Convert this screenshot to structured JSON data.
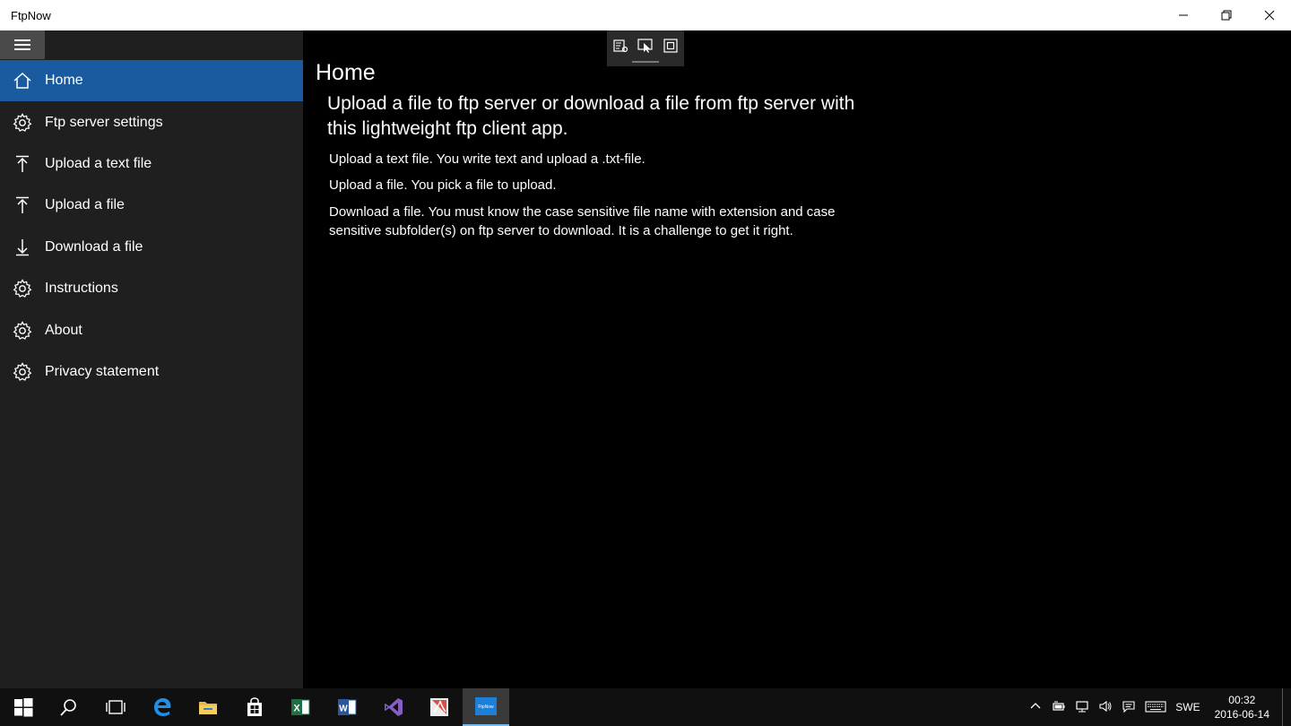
{
  "window": {
    "title": "FtpNow"
  },
  "sidebar": {
    "items": [
      {
        "label": "Home",
        "icon": "home-icon",
        "active": true
      },
      {
        "label": "Ftp server settings",
        "icon": "gear-icon"
      },
      {
        "label": "Upload a text file",
        "icon": "upload-icon"
      },
      {
        "label": "Upload a file",
        "icon": "upload-icon"
      },
      {
        "label": "Download a file",
        "icon": "download-icon"
      },
      {
        "label": "Instructions",
        "icon": "gear-icon"
      },
      {
        "label": "About",
        "icon": "gear-icon"
      },
      {
        "label": "Privacy statement",
        "icon": "gear-icon"
      }
    ]
  },
  "main": {
    "title": "Home",
    "intro": "Upload a file to ftp server or download a file from ftp server with this lightweight ftp client app.",
    "paragraphs": [
      "Upload a text file. You write text and upload a .txt-file.",
      "Upload a file. You pick a file to upload.",
      "Download a file. You must know the case sensitive file name with extension and case sensitive subfolder(s) on ftp server to download. It is a challenge to get it right."
    ]
  },
  "taskbar": {
    "apps": [
      "start-icon",
      "search-icon",
      "task-view-icon",
      "edge-icon",
      "file-explorer-icon",
      "store-icon",
      "excel-icon",
      "word-icon",
      "visual-studio-icon",
      "acrobat-icon",
      "ftpnow-icon"
    ],
    "active_app_label": "FtpNow",
    "language": "SWE",
    "time": "00:32",
    "date": "2016-06-14"
  },
  "colors": {
    "accent": "#1a5a9e",
    "sidebar_bg": "#1f1f1f",
    "main_bg": "#000000",
    "taskbar_bg": "#101010"
  }
}
